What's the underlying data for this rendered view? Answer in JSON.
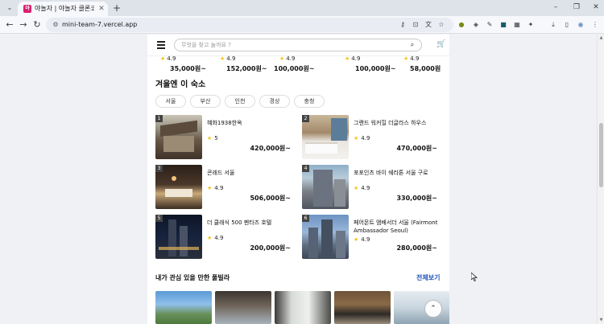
{
  "browser": {
    "tab_title": "야놀자 | 야놀자 클론코딩 사이",
    "url": "mini-team-7.vercel.app",
    "tab_favicon": "야",
    "icons": {
      "tab_menu": "tab-search-icon",
      "tab_close": "close-icon",
      "new_tab": "plus-icon",
      "back": "arrow-left-icon",
      "forward": "arrow-right-icon",
      "reload": "reload-icon",
      "site_info": "tune-icon"
    },
    "win": {
      "minimize": "–",
      "restore": "❐",
      "close": "✕"
    }
  },
  "header": {
    "search_placeholder": "무엇을 찾고 놀까요 ?"
  },
  "top_row": [
    {
      "rating": "4.9",
      "price": "35,000원~"
    },
    {
      "rating": "4.9",
      "price": "152,000원~"
    },
    {
      "rating": "4.9",
      "price": "100,000원~"
    },
    {
      "rating": "4.9",
      "price": "100,000원~"
    },
    {
      "rating": "4.9",
      "price": "58,000원"
    }
  ],
  "winter_section": {
    "title": "겨울엔 이 숙소",
    "regions": [
      "서울",
      "부산",
      "인천",
      "경상",
      "충청"
    ],
    "items": [
      {
        "rank": "1",
        "name": "혜화1938한옥",
        "rating": "5",
        "price": "420,000원~"
      },
      {
        "rank": "2",
        "name": "그랜드 워커힐 더글라스 하우스",
        "rating": "4.9",
        "price": "470,000원~"
      },
      {
        "rank": "3",
        "name": "콘래드 서울",
        "rating": "4.9",
        "price": "506,000원~"
      },
      {
        "rank": "4",
        "name": "포포인츠 바이 쉐라톤 서울 구로",
        "rating": "4.9",
        "price": "330,000원~"
      },
      {
        "rank": "5",
        "name": "더 클래식 500 펜타즈 호텔",
        "rating": "4.9",
        "price": "200,000원~"
      },
      {
        "rank": "6",
        "name": "페어몬트 앰배서더 서울 (Fairmont Ambassador Seoul)",
        "rating": "4.9",
        "price": "280,000원~"
      }
    ]
  },
  "villa_section": {
    "title": "내가 관심 있을 만한 풀빌라",
    "see_all": "전체보기"
  },
  "colors": {
    "accent_link": "#1f54b8",
    "star": "#f5c518",
    "favicon": "#d91f6f"
  }
}
